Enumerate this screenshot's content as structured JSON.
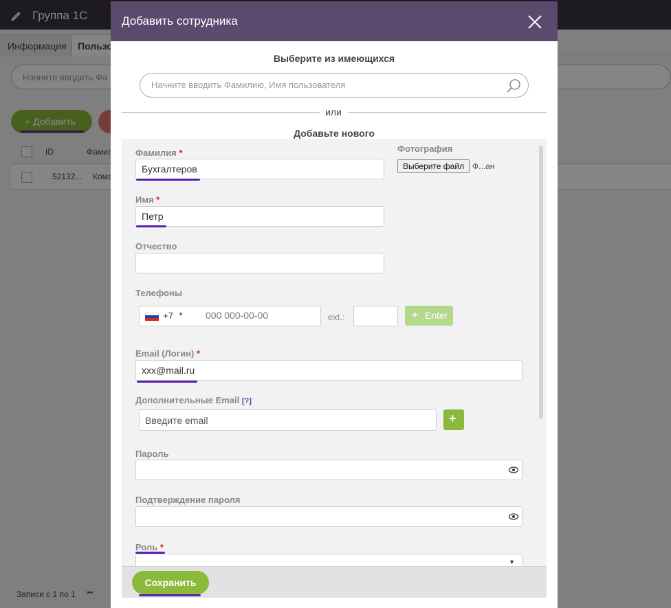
{
  "background": {
    "group_title": "Группа 1С",
    "tabs": [
      {
        "label": "Информация"
      },
      {
        "label": "Пользо"
      }
    ],
    "search_placeholder": "Начните вводить Фа",
    "add_button": "+ Добавить",
    "table": {
      "headers": [
        "ID",
        "Фамил"
      ],
      "rows": [
        [
          "52132...",
          "Кома"
        ]
      ]
    },
    "footer_text": "Записи с 1 по 1"
  },
  "modal": {
    "title": "Добавить сотрудника",
    "choose_existing": "Выберите из имеющихся",
    "search_placeholder": "Начните вводить Фамилию, Имя пользователя",
    "or_text": "или",
    "add_new": "Добавьте нового",
    "fields": {
      "last_name": {
        "label": "Фамилия",
        "value": "Бухгалтеров"
      },
      "first_name": {
        "label": "Имя",
        "value": "Петр"
      },
      "patronymic": {
        "label": "Отчество",
        "value": ""
      },
      "photo": {
        "label": "Фотография",
        "button": "Выберите файл",
        "file_text": "Ф...ан"
      },
      "phones": {
        "label": "Телефоны",
        "code": "+7",
        "placeholder": "000 000-00-00",
        "ext_label": "ext.:",
        "enter_button": "Enter"
      },
      "email": {
        "label": "Email (Логин)",
        "value": "xxx@mail.ru"
      },
      "extra_email": {
        "label": "Дополнительные Email",
        "help": "[?]",
        "placeholder": "Введите email"
      },
      "password": {
        "label": "Пароль"
      },
      "password_confirm": {
        "label": "Подтверждение пароля"
      },
      "role": {
        "label": "Роль"
      }
    },
    "required_mark": "*",
    "save_button": "Сохранить"
  },
  "colors": {
    "header": "#5c4a6e",
    "accent_green": "#8ab93b",
    "underline": "#5a1fb0",
    "required": "#e02020"
  }
}
